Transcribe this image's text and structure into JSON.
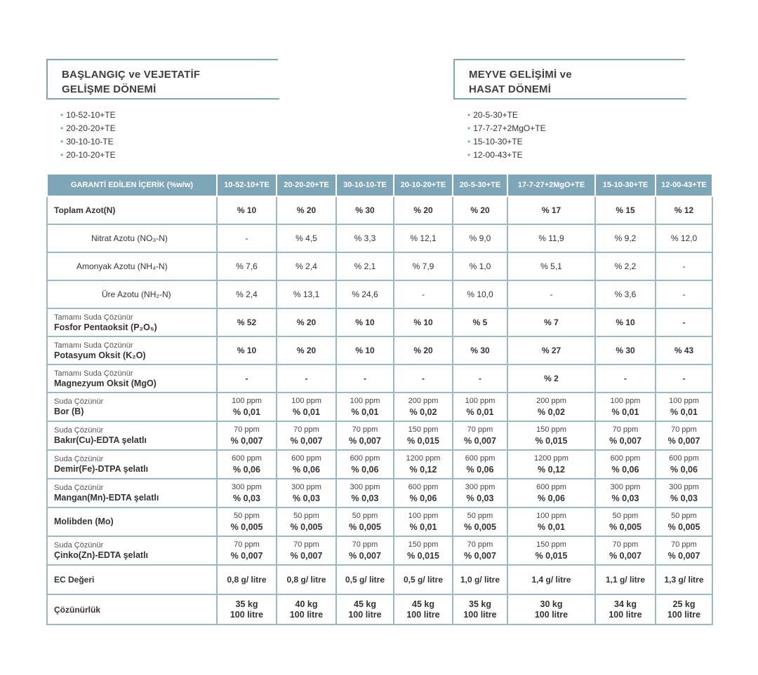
{
  "left_section": {
    "title_line1": "BAŞLANGIÇ ve VEJETATİF",
    "title_line2": "GELİŞME DÖNEMİ",
    "items": [
      "10-52-10+TE",
      "20-20-20+TE",
      "30-10-10-TE",
      "20-10-20+TE"
    ]
  },
  "right_section": {
    "title_line1": "MEYVE GELİŞİMİ ve",
    "title_line2": "HASAT DÖNEMİ",
    "items": [
      "20-5-30+TE",
      "17-7-27+2MgO+TE",
      "15-10-30+TE",
      "12-00-43+TE"
    ]
  },
  "table": {
    "headers": [
      "GARANTİ EDİLEN İÇERİK (%w/w)",
      "10-52-10+TE",
      "20-20-20+TE",
      "30-10-10-TE",
      "20-10-20+TE",
      "20-5-30+TE",
      "17-7-27+2MgO+TE",
      "15-10-30+TE",
      "12-00-43+TE"
    ],
    "simple_rows": [
      {
        "label": "Toplam Azot(N)",
        "values": [
          "% 10",
          "% 20",
          "% 30",
          "% 20",
          "% 20",
          "% 17",
          "% 15",
          "% 12"
        ]
      },
      {
        "label": "Nitrat Azotu (NO₃-N)",
        "values": [
          "-",
          "% 4,5",
          "% 3,3",
          "% 12,1",
          "% 9,0",
          "% 11,9",
          "% 9,2",
          "% 12,0"
        ]
      },
      {
        "label": "Amonyak Azotu (NH₄-N)",
        "values": [
          "% 7,6",
          "% 2,4",
          "% 2,1",
          "% 7,9",
          "% 1,0",
          "% 5,1",
          "% 2,2",
          "-"
        ]
      },
      {
        "label": "Üre Azotu (NH₂-N)",
        "values": [
          "% 2,4",
          "% 13,1",
          "% 24,6",
          "-",
          "% 10,0",
          "-",
          "% 3,6",
          "-"
        ]
      }
    ],
    "sub_rows": [
      {
        "sub": "Tamamı Suda Çözünür",
        "label": "Fosfor Pentaoksit (P₂O₅)",
        "values": [
          "% 52",
          "% 20",
          "% 10",
          "% 10",
          "% 5",
          "% 7",
          "% 10",
          "-"
        ]
      },
      {
        "sub": "Tamamı Suda Çözünür",
        "label": "Potasyum Oksit (K₂O)",
        "values": [
          "% 10",
          "% 20",
          "% 10",
          "% 20",
          "% 30",
          "% 27",
          "% 30",
          "% 43"
        ]
      },
      {
        "sub": "Tamamı Suda Çözünür",
        "label": "Magnezyum Oksit (MgO)",
        "values": [
          "-",
          "-",
          "-",
          "-",
          "-",
          "% 2",
          "-",
          "-"
        ]
      }
    ],
    "micro_rows": [
      {
        "sub": "Suda Çözünür",
        "label": "Bor (B)",
        "ppm": [
          "100 ppm",
          "100 ppm",
          "100 ppm",
          "200 ppm",
          "100 ppm",
          "200 ppm",
          "100 ppm",
          "100 ppm"
        ],
        "pct": [
          "% 0,01",
          "% 0,01",
          "% 0,01",
          "% 0,02",
          "% 0,01",
          "% 0,02",
          "% 0,01",
          "% 0,01"
        ]
      },
      {
        "sub": "Suda Çözünür",
        "label": "Bakır(Cu)-EDTA şelatlı",
        "ppm": [
          "70 ppm",
          "70 ppm",
          "70 ppm",
          "150 ppm",
          "70 ppm",
          "150 ppm",
          "70 ppm",
          "70 ppm"
        ],
        "pct": [
          "% 0,007",
          "% 0,007",
          "% 0,007",
          "% 0,015",
          "% 0,007",
          "% 0,015",
          "% 0,007",
          "% 0,007"
        ]
      },
      {
        "sub": "Suda Çözünür",
        "label": "Demir(Fe)-DTPA şelatlı",
        "ppm": [
          "600 ppm",
          "600 ppm",
          "600 ppm",
          "1200 ppm",
          "600 ppm",
          "1200 ppm",
          "600 ppm",
          "600 ppm"
        ],
        "pct": [
          "% 0,06",
          "% 0,06",
          "% 0,06",
          "% 0,12",
          "% 0,06",
          "% 0,12",
          "% 0,06",
          "% 0,06"
        ]
      },
      {
        "sub": "Suda Çözünür",
        "label": "Mangan(Mn)-EDTA şelatlı",
        "ppm": [
          "300 ppm",
          "300 ppm",
          "300 ppm",
          "600 ppm",
          "300 ppm",
          "600 ppm",
          "300 ppm",
          "300 ppm"
        ],
        "pct": [
          "% 0,03",
          "% 0,03",
          "% 0,03",
          "% 0,06",
          "% 0,03",
          "% 0,06",
          "% 0,03",
          "% 0,03"
        ]
      },
      {
        "sub": "",
        "label": "Molibden (Mo)",
        "ppm": [
          "50 ppm",
          "50 ppm",
          "50 ppm",
          "100 ppm",
          "50 ppm",
          "100 ppm",
          "50 ppm",
          "50 ppm"
        ],
        "pct": [
          "% 0,005",
          "% 0,005",
          "% 0,005",
          "% 0,01",
          "% 0,005",
          "% 0,01",
          "% 0,005",
          "% 0,005"
        ]
      },
      {
        "sub": "Suda Çözünür",
        "label": "Çinko(Zn)-EDTA şelatlı",
        "ppm": [
          "70 ppm",
          "70 ppm",
          "70 ppm",
          "150 ppm",
          "70 ppm",
          "150 ppm",
          "70 ppm",
          "70 ppm"
        ],
        "pct": [
          "% 0,007",
          "% 0,007",
          "% 0,007",
          "% 0,015",
          "% 0,007",
          "% 0,015",
          "% 0,007",
          "% 0,007"
        ]
      }
    ],
    "ec_row": {
      "label": "EC Değeri",
      "values": [
        "0,8 g/ litre",
        "0,8 g/ litre",
        "0,5 g/ litre",
        "0,5 g/ litre",
        "1,0 g/ litre",
        "1,4 g/ litre",
        "1,1 g/ litre",
        "1,3 g/ litre"
      ]
    },
    "solubility_row": {
      "label": "Çözünürlük",
      "kg": [
        "35 kg",
        "40 kg",
        "45 kg",
        "45 kg",
        "35 kg",
        "30 kg",
        "34 kg",
        "25 kg"
      ],
      "litre": [
        "100 litre",
        "100 litre",
        "100 litre",
        "100 litre",
        "100 litre",
        "100 litre",
        "100 litre",
        "100 litre"
      ]
    }
  }
}
